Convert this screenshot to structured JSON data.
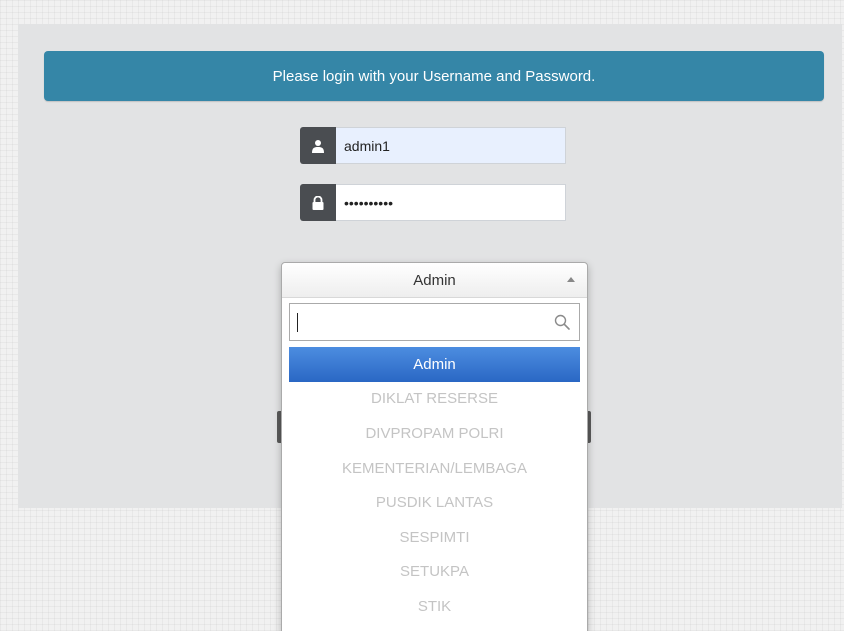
{
  "login": {
    "notice": "Please login with your Username and Password.",
    "username_value": "admin1",
    "password_value": "••••••••••",
    "user_icon": "user-icon",
    "lock_icon": "lock-icon"
  },
  "role_select": {
    "selected": "Admin",
    "search_value": "",
    "options": [
      "Admin",
      "DIKLAT RESERSE",
      "DIVPROPAM POLRI",
      "KEMENTERIAN/LEMBAGA",
      "PUSDIK LANTAS",
      "SESPIMTI",
      "SETUKPA",
      "STIK"
    ],
    "highlighted_index": 0
  },
  "colors": {
    "notice_bg": "#3586a7",
    "addon_bg": "#4a4d51",
    "highlight": "#3a7bd5",
    "disabled_text": "#c4c4c4"
  }
}
